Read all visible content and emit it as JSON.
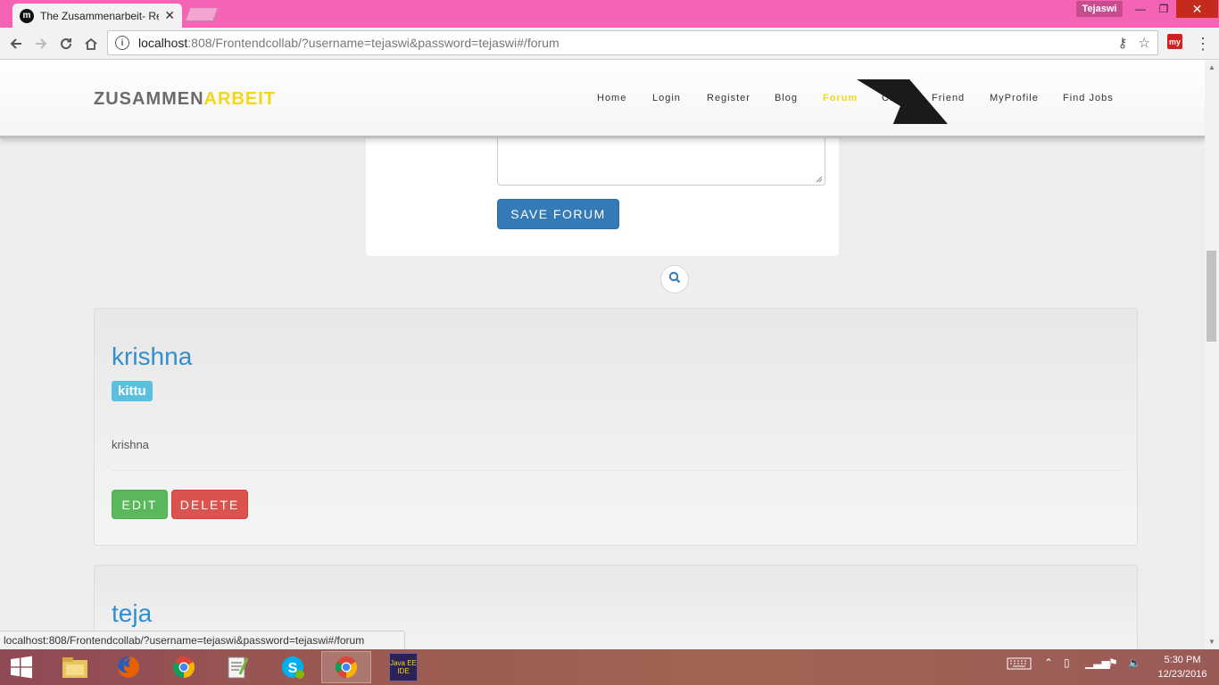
{
  "browser": {
    "tab_title": "The Zusammenarbeit- Re",
    "tab_favicon": "m",
    "profile_name": "Tejaswi",
    "url_host": "localhost",
    "url_path": ":808/Frontendcollab/?username=tejaswi&password=tejaswi#/forum",
    "extension_label": "my",
    "status_url": "localhost:808/Frontendcollab/?username=tejaswi&password=tejaswi#/forum"
  },
  "site": {
    "brand_part1": "ZUSAMMEN",
    "brand_part2": "ARBEIT",
    "nav": [
      {
        "label": "Home"
      },
      {
        "label": "Login"
      },
      {
        "label": "Register"
      },
      {
        "label": "Blog"
      },
      {
        "label": "Forum",
        "active": true
      },
      {
        "label": "Chat"
      },
      {
        "label": "Friend"
      },
      {
        "label": "MyProfile"
      },
      {
        "label": "Find Jobs"
      }
    ]
  },
  "form": {
    "save_label": "SAVE FORUM"
  },
  "forums": [
    {
      "title": "krishna",
      "tag": "kittu",
      "body": "krishna",
      "edit_label": "EDIT",
      "delete_label": "DELETE"
    },
    {
      "title": "teja"
    }
  ],
  "taskbar": {
    "time": "5:30 PM",
    "date": "12/23/2016",
    "apps": [
      "file-explorer",
      "firefox",
      "chrome",
      "notepad-plus-plus",
      "skype",
      "chrome-active",
      "java-ee-ide"
    ],
    "java_label": "Java EE IDE"
  },
  "colors": {
    "titlebar": "#f564b4",
    "brand_accent": "#f4d619",
    "primary": "#337ab7",
    "success": "#5cb85c",
    "danger": "#d9534f",
    "info": "#5bc0de",
    "link": "#2f8fd0"
  }
}
